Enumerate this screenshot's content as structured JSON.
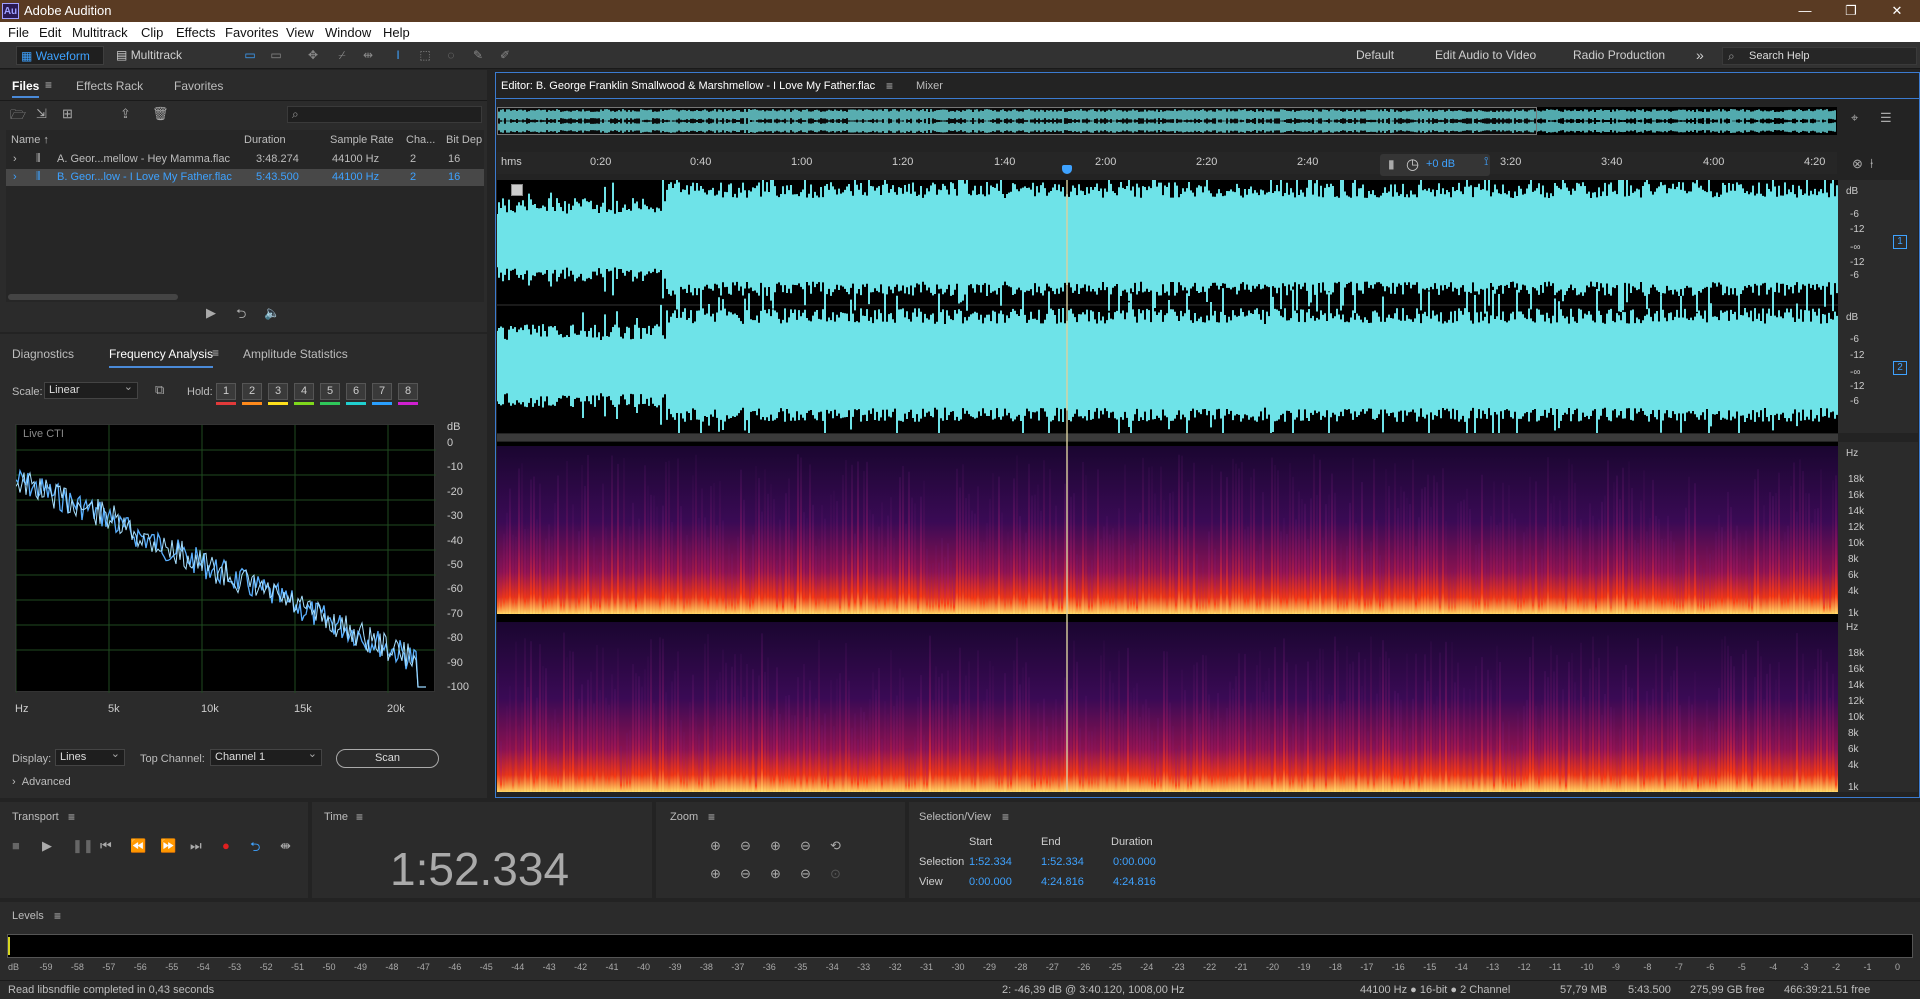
{
  "window": {
    "title": "Adobe Audition",
    "logo": "Au",
    "controls": [
      "—",
      "❐",
      "✕"
    ]
  },
  "menu": [
    "File",
    "Edit",
    "Multitrack",
    "Clip",
    "Effects",
    "Favorites",
    "View",
    "Window",
    "Help"
  ],
  "toolbar": {
    "waveform": "Waveform",
    "multitrack": "Multitrack",
    "workspaces": [
      "Default",
      "Edit Audio to Video",
      "Radio Production"
    ],
    "more": "»",
    "search_placeholder": "Search Help"
  },
  "files_panel": {
    "tabs": [
      "Files",
      "Effects Rack",
      "Favorites"
    ],
    "columns": [
      "Name ↑",
      "Duration",
      "Sample Rate",
      "Cha...",
      "Bit Dep"
    ],
    "rows": [
      {
        "name": "A. Geor...mellow - Hey Mamma.flac",
        "duration": "3:48.274",
        "rate": "44100 Hz",
        "ch": "2",
        "bits": "16",
        "selected": false
      },
      {
        "name": "B. Geor...low - I Love My Father.flac",
        "duration": "5:43.500",
        "rate": "44100 Hz",
        "ch": "2",
        "bits": "16",
        "selected": true
      }
    ]
  },
  "analysis_panel": {
    "tabs": [
      "Diagnostics",
      "Frequency Analysis",
      "Amplitude Statistics"
    ],
    "scale_label": "Scale:",
    "scale_value": "Linear",
    "hold_label": "Hold:",
    "holds": [
      {
        "n": "1",
        "c": "#e23a3a"
      },
      {
        "n": "2",
        "c": "#ff8a1c"
      },
      {
        "n": "3",
        "c": "#ffe01c"
      },
      {
        "n": "4",
        "c": "#7fd81c"
      },
      {
        "n": "5",
        "c": "#2fc85a"
      },
      {
        "n": "6",
        "c": "#20d0d0"
      },
      {
        "n": "7",
        "c": "#2aa0ff"
      },
      {
        "n": "8",
        "c": "#d020d0"
      }
    ],
    "graph_label": "Live CTI",
    "db_unit": "dB",
    "db_ticks": [
      "0",
      "-10",
      "-20",
      "-30",
      "-40",
      "-50",
      "-60",
      "-70",
      "-80",
      "-90",
      "-100"
    ],
    "hz_ticks": [
      "Hz",
      "5k",
      "10k",
      "15k",
      "20k"
    ],
    "display_label": "Display:",
    "display_value": "Lines",
    "channel_label": "Top Channel:",
    "channel_value": "Channel 1",
    "scan": "Scan",
    "advanced": "Advanced"
  },
  "editor": {
    "tabs": [
      "Editor: B. George Franklin Smallwood & Marshmellow - I Love My Father.flac",
      "Mixer"
    ],
    "ruler": [
      "hms",
      "0:20",
      "0:40",
      "1:00",
      "1:20",
      "1:40",
      "2:00",
      "2:20",
      "2:40",
      "3:20",
      "3:40",
      "4:00",
      "4:20"
    ],
    "gain": "+0 dB",
    "db_scale": [
      "dB",
      "-6",
      "-12",
      "-∞",
      "-12",
      "-6"
    ],
    "channels": [
      "1",
      "2"
    ],
    "hz_unit": "Hz",
    "hz_scale": [
      "18k",
      "16k",
      "14k",
      "12k",
      "10k",
      "8k",
      "6k",
      "4k",
      "1k"
    ],
    "playhead_pos": 0.424
  },
  "transport": {
    "label": "Transport"
  },
  "time": {
    "label": "Time",
    "value": "1:52.334"
  },
  "zoom": {
    "label": "Zoom"
  },
  "selection": {
    "label": "Selection/View",
    "cols": [
      "Start",
      "End",
      "Duration"
    ],
    "rows": [
      {
        "label": "Selection",
        "start": "1:52.334",
        "end": "1:52.334",
        "dur": "0:00.000"
      },
      {
        "label": "View",
        "start": "0:00.000",
        "end": "4:24.816",
        "dur": "4:24.816"
      }
    ]
  },
  "levels": {
    "label": "Levels",
    "ticks": [
      "dB",
      "-59",
      "-58",
      "-57",
      "-56",
      "-55",
      "-54",
      "-53",
      "-52",
      "-51",
      "-50",
      "-49",
      "-48",
      "-47",
      "-46",
      "-45",
      "-44",
      "-43",
      "-42",
      "-41",
      "-40",
      "-39",
      "-38",
      "-37",
      "-36",
      "-35",
      "-34",
      "-33",
      "-32",
      "-31",
      "-30",
      "-29",
      "-28",
      "-27",
      "-26",
      "-25",
      "-24",
      "-23",
      "-22",
      "-21",
      "-20",
      "-19",
      "-18",
      "-17",
      "-16",
      "-15",
      "-14",
      "-13",
      "-12",
      "-11",
      "-10",
      "-9",
      "-8",
      "-7",
      "-6",
      "-5",
      "-4",
      "-3",
      "-2",
      "-1",
      "0"
    ]
  },
  "status": {
    "left": "Read libsndfile completed in 0,43 seconds",
    "mid": "2: -46,39 dB @ 3:40.120, 1008,00 Hz",
    "format": "44100 Hz ● 16-bit ● 2 Channel",
    "size": "57,79 MB",
    "dur": "5:43.500",
    "free": "275,99 GB free",
    "time_free": "466:39:21.51 free"
  }
}
